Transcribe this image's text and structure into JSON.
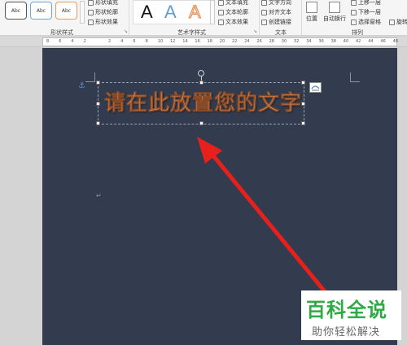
{
  "ribbon": {
    "shape_styles": {
      "swatches": [
        "Abc",
        "Abc",
        "Abc"
      ],
      "fill": "形状填充",
      "outline": "形状轮廓",
      "effects": "形状效果",
      "group_label": "形状样式"
    },
    "wordart_styles": {
      "samples": [
        "A",
        "A",
        "A"
      ],
      "fill": "文本填充",
      "outline": "文本轮廓",
      "effects": "文本效果",
      "group_label": "艺术字样式"
    },
    "text": {
      "direction": "文字方向",
      "align": "对齐文本",
      "link": "创建链接",
      "group_label": "文本"
    },
    "arrange": {
      "position": "位置",
      "wrap": "自动换行",
      "bring_forward": "上移一层",
      "send_backward": "下移一层",
      "selection_pane": "选择窗格",
      "rotate": "旋转",
      "group_label": "排列"
    }
  },
  "ruler": {
    "ticks": [
      "8",
      "6",
      "4",
      "2",
      "",
      "2",
      "4",
      "6",
      "8",
      "10",
      "12",
      "14",
      "16",
      "18",
      "20",
      "22",
      "24",
      "26",
      "28",
      "30",
      "32",
      "34",
      "36",
      "38",
      "40",
      "42",
      "44",
      "46",
      "48"
    ]
  },
  "document": {
    "textbox_text": "请在此放置您的文字",
    "paragraph_mark": "↵"
  },
  "watermark": {
    "title": "百科全说",
    "subtitle": "助你轻松解决"
  },
  "colors": {
    "page_bg": "#333c4e",
    "wordart_fill": "#f3b085",
    "arrow": "#e8201c",
    "watermark_green": "#2faa44"
  },
  "icons": {
    "anchor": "anchor-icon",
    "rotate": "rotate-handle-icon",
    "layout_options": "layout-options-icon"
  }
}
